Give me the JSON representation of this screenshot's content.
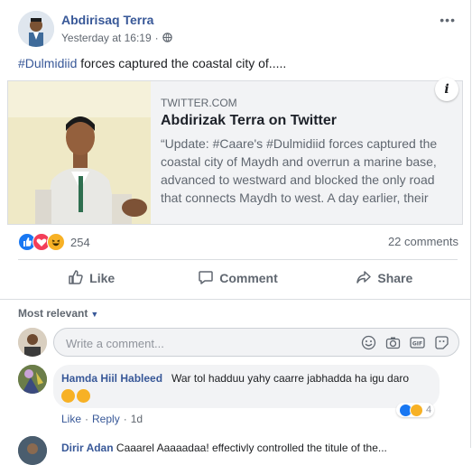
{
  "post": {
    "author": "Abdirisaq Terra",
    "timestamp": "Yesterday at 16:19",
    "privacy_icon": "globe-icon",
    "more_label": "•••",
    "hashtag": "#Dulmidiid",
    "text_rest": " forces captured the coastal city of....."
  },
  "link_preview": {
    "domain": "TWITTER.COM",
    "title": "Abdirizak Terra on Twitter",
    "description": "“Update: #Caare's #Dulmidiid forces captured the coastal city of Maydh and overrun a marine base, advanced to westward and blocked the only road that connects Maydh to west. A day earlier, their forces",
    "info_label": "i"
  },
  "reactions": {
    "count": "254",
    "types": [
      "like",
      "love",
      "haha"
    ],
    "comments_count": "22 comments"
  },
  "actions": {
    "like": "Like",
    "comment": "Comment",
    "share": "Share"
  },
  "comments_section": {
    "sort_label": "Most relevant",
    "input_placeholder": "Write a comment...",
    "input_icons": [
      "emoji-icon",
      "camera-icon",
      "gif-icon",
      "sticker-icon"
    ]
  },
  "comments": [
    {
      "author": "Hamda Hiil Hableed",
      "text": "War tol hadduu yahy caarre jabhadda ha igu daro",
      "reaction_count": "4",
      "like": "Like",
      "reply": "Reply",
      "time": "1d"
    },
    {
      "author": "Dirir Adan",
      "text": "Caaarel Aaaaadaa! effectivly controlled the titule of the..."
    }
  ],
  "colors": {
    "link_blue": "#385898",
    "like_blue": "#1877f2",
    "love_red": "#f33e58",
    "haha_yellow": "#f7b125",
    "secondary_text": "#606770"
  }
}
